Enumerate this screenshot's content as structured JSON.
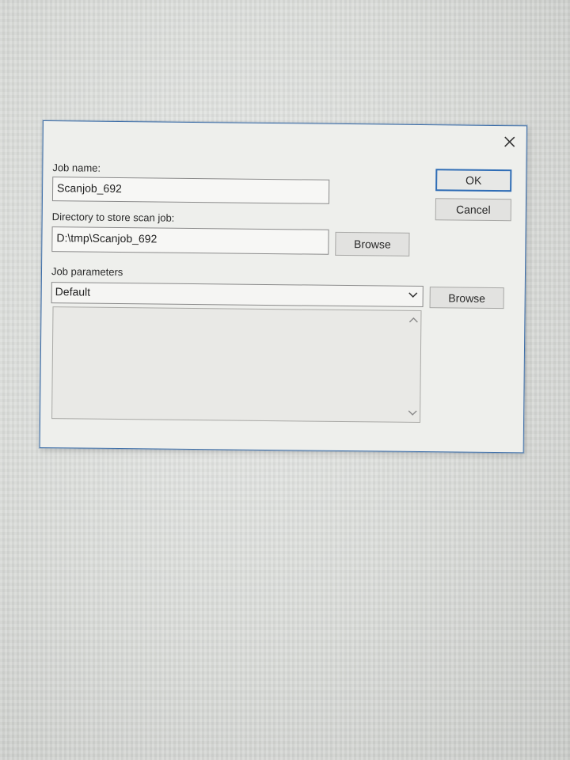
{
  "dialog": {
    "close_icon": "close-icon",
    "job_name": {
      "label": "Job name:",
      "value": "Scanjob_692"
    },
    "directory": {
      "label": "Directory to store scan job:",
      "value": "D:\\tmp\\Scanjob_692",
      "browse_label": "Browse"
    },
    "job_parameters": {
      "label": "Job parameters",
      "selected": "Default",
      "browse_label": "Browse"
    },
    "buttons": {
      "ok_label": "OK",
      "cancel_label": "Cancel"
    },
    "colors": {
      "accent": "#2f6db6",
      "border": "#3f6fa8"
    }
  }
}
